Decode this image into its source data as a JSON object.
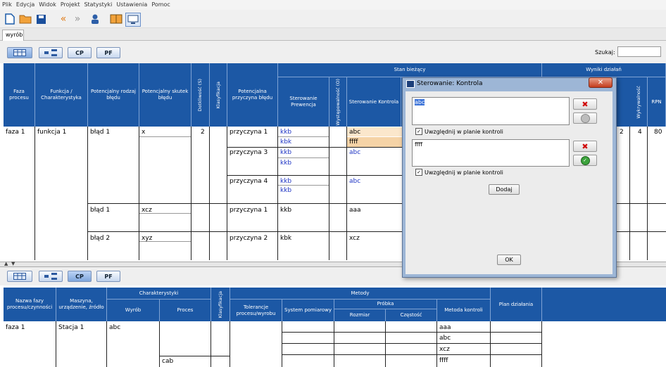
{
  "menu": [
    "Plik",
    "Edycja",
    "Widok",
    "Projekt",
    "Statystyki",
    "Ustawienia",
    "Pomoc"
  ],
  "tab": "wyrób",
  "view_buttons": [
    "CP",
    "PF"
  ],
  "search_label": "Szukaj:",
  "top_table": {
    "group_headers": {
      "stan": "Stan bieżący",
      "wyniki": "Wyniki działań"
    },
    "headers": {
      "faza": "Faza procesu",
      "funkcja": "Funkcja / Charakterystyka",
      "rodzaj": "Potencjalny rodzaj błędu",
      "skutek": "Potencjalny skutek błędu",
      "dotkliwosc": "Dotkliwość (S)",
      "klasyfikacja": "Klasyfikacja",
      "przyczyna": "Potencjalna przyczyna błędu",
      "prewencja": "Sterowanie Prewencja",
      "wystepowalnosc": "Występowalność (O)",
      "kontrola": "Sterowanie Kontrola",
      "wykrywalnosc": "Wykrywalność",
      "rpn": "RPN"
    },
    "rows": {
      "faza": "faza 1",
      "funkcja": "funkcja 1",
      "blad1": "błąd 1",
      "skutek1": "x",
      "dotkliwosc1": "2",
      "przyczyna1": "przyczyna 1",
      "prew1a": "kkb",
      "prew1b": "kbk",
      "kontr1a": "abc",
      "kontr1b": "ffff",
      "przyczyna3": "przyczyna 3",
      "prew3a": "kkb",
      "prew3b": "kkb",
      "kontr3": "abc",
      "przyczyna4": "przyczyna 4",
      "prew4a": "kkb",
      "prew4b": "kkb",
      "kontr4": "abc",
      "blad1b": "błąd 1",
      "skutek2": "xcz",
      "przyczyna1b": "przyczyna 1",
      "prew5": "kkb",
      "kontr5": "aaa",
      "blad2": "błąd 2",
      "skutek3": "xyz",
      "przyczyna2": "przyczyna 2",
      "prew6": "kbk",
      "kontr6": "xcz",
      "res_s": "2",
      "res_w": "4",
      "res_rpn": "80"
    }
  },
  "bottom_table": {
    "headers": {
      "nazwa": "Nazwa fazy procesu/czynności",
      "maszyna": "Maszyna, urządzenie, źródło",
      "charakterystyki": "Charakterystyki",
      "wyrob": "Wyrób",
      "proces": "Proces",
      "klasyfikacja": "Klasyfikacja",
      "metody": "Metody",
      "tolerancje": "Tolerancje procesu/wyrobu",
      "system": "System pomiarowy",
      "probka": "Próbka",
      "rozmiar": "Rozmiar",
      "czestosc": "Częstość",
      "metoda_kontroli": "Metoda kontroli",
      "plan": "Plan działania"
    },
    "rows": {
      "faza": "faza 1",
      "stacja": "Stacja 1",
      "wyrob": "abc",
      "proces_cab": "cab",
      "metody": [
        "aaa",
        "abc",
        "xcz",
        "ffff"
      ]
    }
  },
  "dialog": {
    "title": "Sterowanie: Kontrola",
    "close_symbol": "✕",
    "entry1": "abc",
    "entry2": "ffff",
    "checkbox_label": "Uwzględnij w planie kontroli",
    "add_button": "Dodaj",
    "ok_button": "OK"
  },
  "colors": {
    "header_blue": "#1c58a5",
    "highlight": "#f9dcb5",
    "link_blue": "#1f35c4"
  }
}
